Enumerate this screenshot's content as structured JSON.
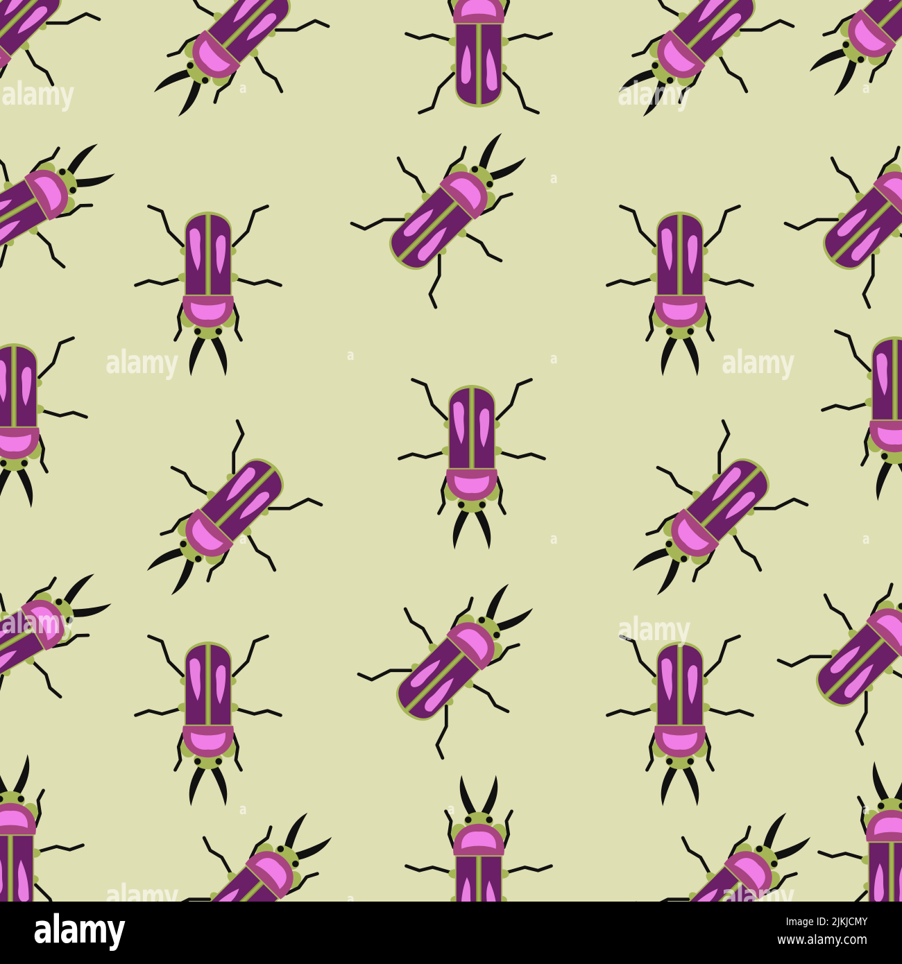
{
  "image": {
    "background_color": "#dfdfb4",
    "beetle_colors": {
      "elytra": "#7a2a78",
      "highlight": "#e87ee0",
      "body": "#a8447f",
      "legs_base": "#a6b656",
      "legs": "#111111"
    },
    "watermark_text": "alamy",
    "watermark_small": "a"
  },
  "footer": {
    "logo": "alamy",
    "image_id": "Image ID: 2JKJCMY",
    "website": "www.alamy.com"
  }
}
